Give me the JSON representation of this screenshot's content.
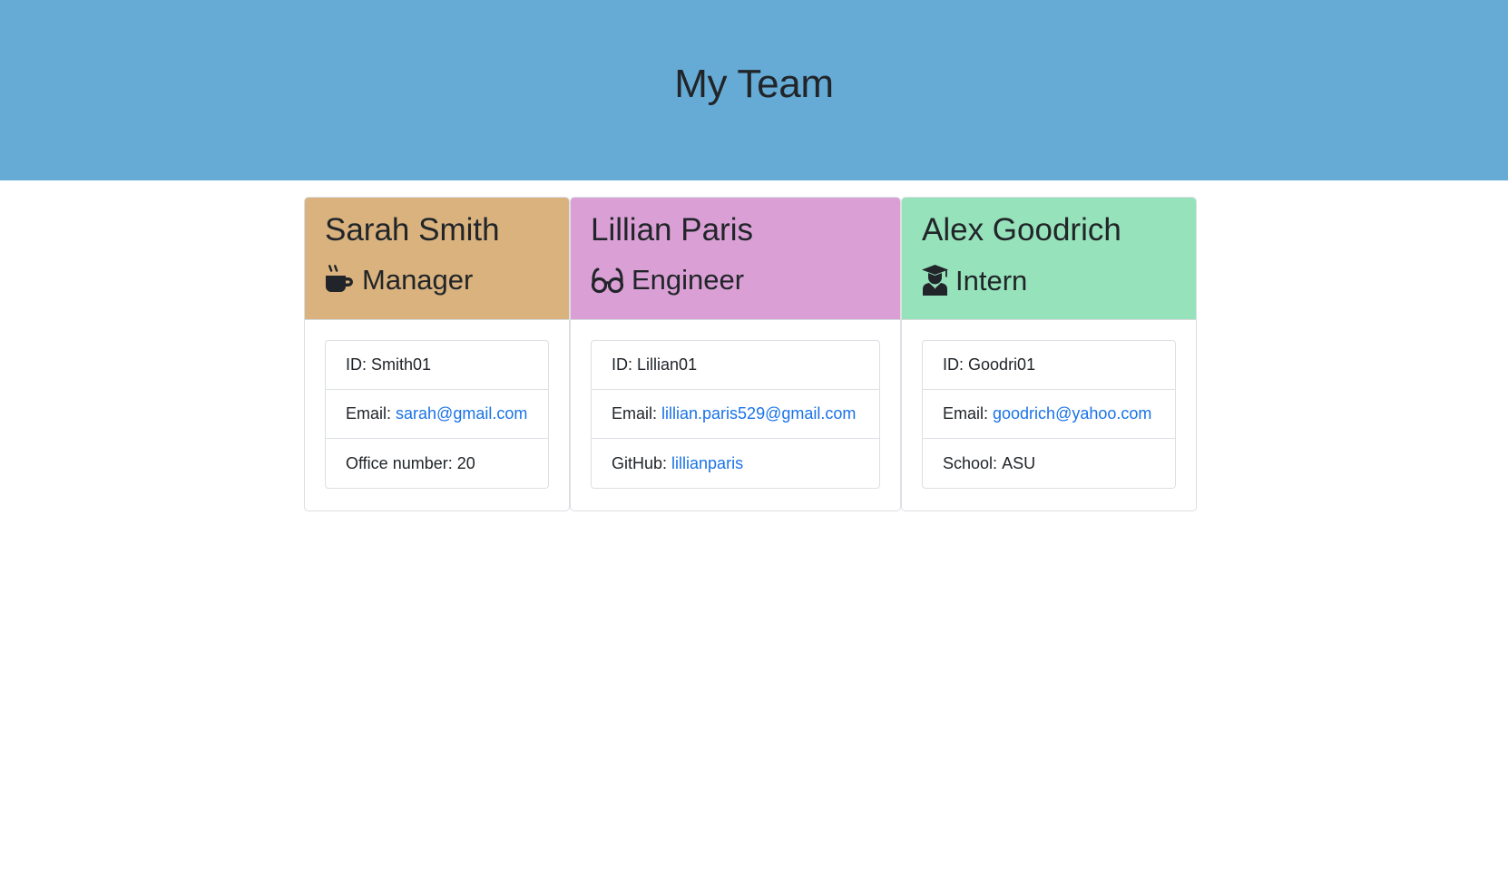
{
  "header": {
    "title": "My Team"
  },
  "colors": {
    "jumbotron": "#66abd6",
    "manager": "#d9b27e",
    "engineer": "#daa0d6",
    "intern": "#96e2bb",
    "link": "#1a73e8"
  },
  "cards": [
    {
      "name": "Sarah Smith",
      "role": "Manager",
      "icon": "coffee-icon",
      "id_label": "ID:",
      "id_value": "Smith01",
      "email_label": "Email:",
      "email": "sarah@gmail.com",
      "extra_label": "Office number:",
      "extra_value": "20"
    },
    {
      "name": "Lillian Paris",
      "role": "Engineer",
      "icon": "glasses-icon",
      "id_label": "ID:",
      "id_value": "Lillian01",
      "email_label": "Email:",
      "email": "lillian.paris529@gmail.com",
      "extra_label": "GitHub:",
      "extra_value": "lillianparis"
    },
    {
      "name": "Alex Goodrich",
      "role": "Intern",
      "icon": "graduate-icon",
      "id_label": "ID:",
      "id_value": "Goodri01",
      "email_label": "Email:",
      "email": "goodrich@yahoo.com",
      "extra_label": "School:",
      "extra_value": "ASU"
    }
  ]
}
